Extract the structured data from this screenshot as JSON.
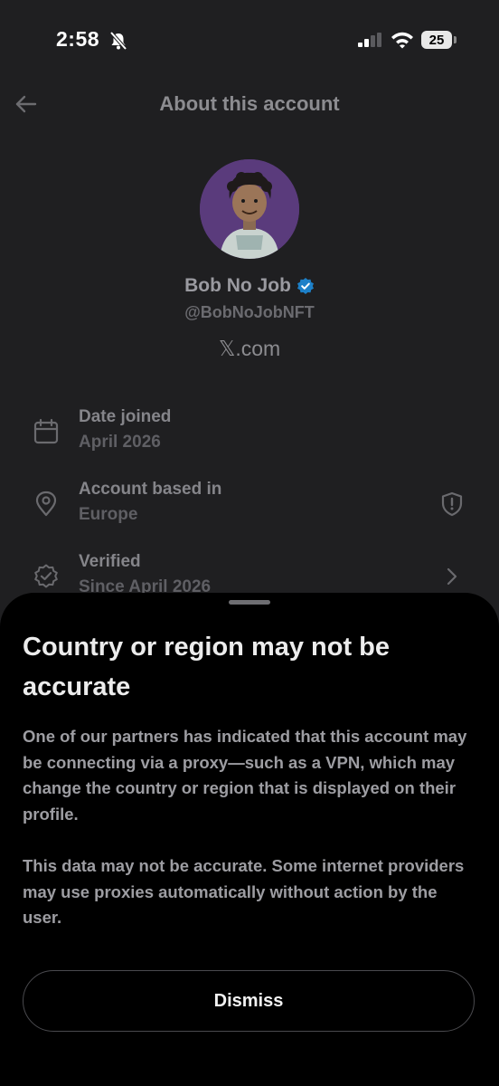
{
  "status_bar": {
    "time": "2:58",
    "battery": "25"
  },
  "header": {
    "title": "About this account"
  },
  "profile": {
    "name": "Bob No Job",
    "handle": "@BobNoJobNFT",
    "site": "𝕏.com"
  },
  "info_rows": [
    {
      "label": "Date joined",
      "value": "April 2026",
      "icon": "calendar-icon"
    },
    {
      "label": "Account based in",
      "value": "Europe",
      "icon": "location-pin-icon",
      "trailing_icon": "shield-warning-icon"
    },
    {
      "label": "Verified",
      "value": "Since April 2026",
      "icon": "verified-badge-icon",
      "trailing_icon": "chevron-right-icon"
    }
  ],
  "sheet": {
    "title": "Country or region may not be accurate",
    "paragraph_1": "One of our partners has indicated that this account may be connecting via a proxy—such as a VPN, which may change the country or region that is displayed on their profile.",
    "paragraph_2": "This data may not be accurate. Some internet providers may use proxies automatically without action by the user.",
    "dismiss_label": "Dismiss"
  },
  "colors": {
    "background": "#1f1f21",
    "sheet_background": "#000000",
    "verified_blue": "#1d9bf0",
    "avatar_purple": "#5a3b7c"
  }
}
